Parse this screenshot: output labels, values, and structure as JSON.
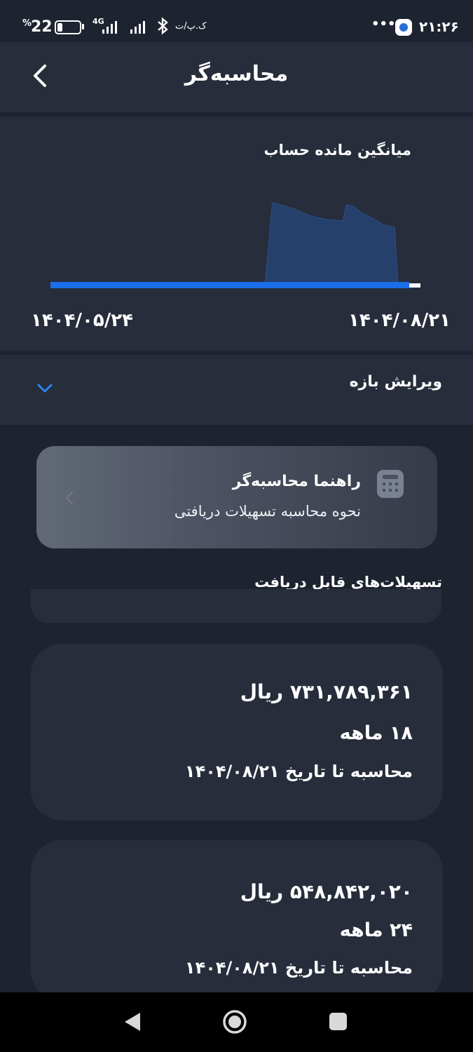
{
  "status_bar": {
    "battery_percent": "22",
    "battery_symbol": "%",
    "battery_level": 0.22,
    "network": "4G",
    "carrier_text": "ک.پ/ت",
    "dots": "•••",
    "time": "۲۱:۲۶"
  },
  "header": {
    "title": "محاسبه‌گر",
    "back_icon": "chevron-left-icon"
  },
  "chart": {
    "title": "میانگین مانده حساب",
    "start_date": "۱۴۰۴/۰۵/۲۴",
    "end_date": "۱۴۰۴/۰۸/۲۱",
    "colors": {
      "area": "#25406b",
      "line": "#1a6ee8",
      "end_marker": "#ffffff"
    }
  },
  "chart_data": {
    "type": "area",
    "title": "میانگین مانده حساب",
    "x_start": "۱۴۰۴/۰۵/۲۴",
    "x_end": "۱۴۰۴/۰۸/۲۱",
    "xlabel": "",
    "ylabel": "",
    "grid": false,
    "series": [
      {
        "x": [
          0,
          0.58,
          0.6,
          0.62,
          0.66,
          0.7,
          0.74,
          0.79,
          0.8,
          0.82,
          0.84,
          0.87,
          0.9,
          0.93,
          0.94,
          1.0
        ],
        "values": [
          0,
          0,
          0.9,
          0.88,
          0.83,
          0.76,
          0.72,
          0.7,
          0.88,
          0.86,
          0.79,
          0.73,
          0.66,
          0.63,
          0,
          0
        ]
      }
    ]
  },
  "range": {
    "label": "ویرایش بازه",
    "icon": "chevron-down-icon"
  },
  "guide": {
    "title": "راهنما محاسبه‌گر",
    "subtitle": "نحوه محاسبه تسهیلات دریافتی",
    "icon": "calculator-icon",
    "arrow_icon": "chevron-left-icon"
  },
  "facilities": {
    "section_title": "تسهیلات‌های قابل دریافت",
    "items": [
      {
        "amount": "۷۳۱,۷۸۹,۳۶۱ ریال",
        "months": "۱۸ ماهه",
        "date_text": "محاسبه تا تاریخ ۱۴۰۴/۰۸/۲۱"
      },
      {
        "amount": "۵۴۸,۸۴۲,۰۲۰ ریال",
        "months": "۲۴ ماهه",
        "date_text": "محاسبه تا تاریخ ۱۴۰۴/۰۸/۲۱"
      }
    ]
  },
  "nav_bar": {
    "back": "triangle-back-icon",
    "home": "circle-home-icon",
    "recents": "square-recents-icon"
  }
}
